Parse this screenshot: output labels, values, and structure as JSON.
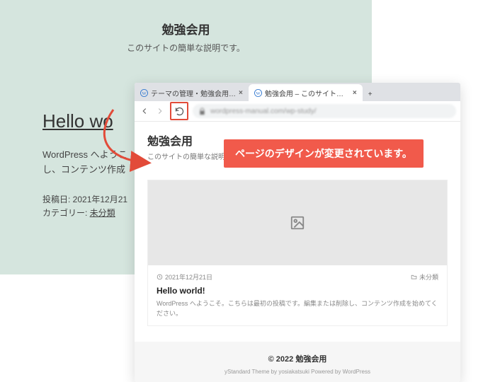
{
  "background": {
    "title": "勉強会用",
    "desc": "このサイトの簡単な説明です。",
    "hello": "Hello wo",
    "welcome_l1": "WordPress へようこ",
    "welcome_l2": "し、コンテンツ作成",
    "meta_date_label": "投稿日: ",
    "meta_date": "2021年12月21",
    "meta_cat_label": "カテゴリー: ",
    "meta_cat": "未分類"
  },
  "browser": {
    "tabs": [
      {
        "label": "テーマの管理・勉強会用 — WordP"
      },
      {
        "label": "勉強会用 – このサイトの簡単な説明"
      }
    ],
    "new_tab": "+",
    "close": "×",
    "address": "wordpress-manual.com/wp-study/"
  },
  "page": {
    "title": "勉強会用",
    "desc": "このサイトの簡単な説明です。",
    "card": {
      "date": "2021年12月21日",
      "category": "未分類",
      "heading": "Hello world!",
      "text": "WordPress へようこそ。こちらは最初の投稿です。編集または削除し、コンテンツ作成を始めてください。"
    },
    "copyright": "© 2022 勉強会用",
    "credit": "yStandard Theme by yosiakatsuki Powered by WordPress"
  },
  "callout": "ページのデザインが変更されています。"
}
